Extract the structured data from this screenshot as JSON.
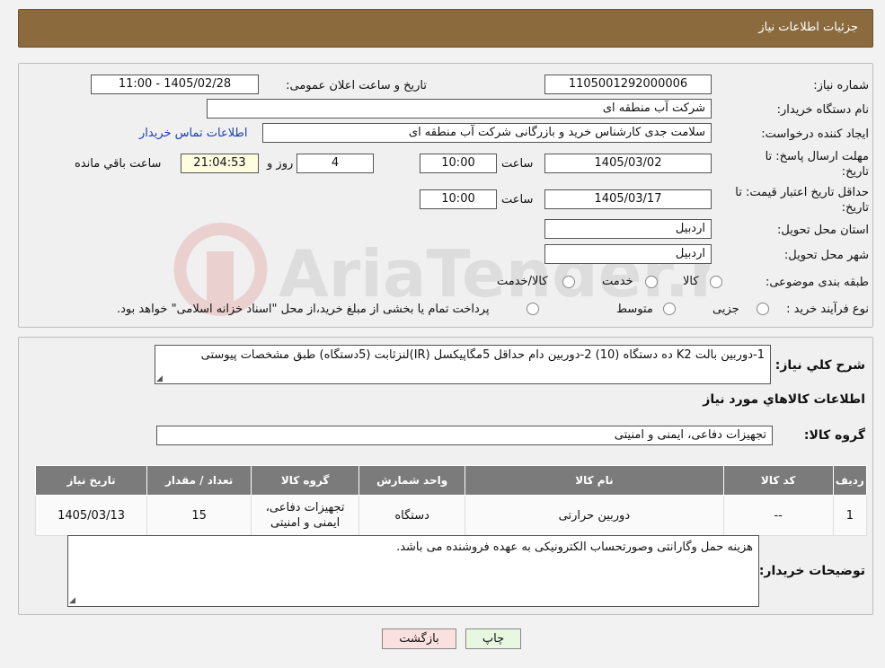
{
  "header": {
    "title": "جزئیات اطلاعات نیاز"
  },
  "details": {
    "need_number_label": "شماره نیاز:",
    "need_number": "1105001292000006",
    "announce_label": "تاریخ و ساعت اعلان عمومی:",
    "announce_value": "1405/02/28 - 11:00",
    "buyer_org_label": "نام دستگاه خریدار:",
    "buyer_org": "شرکت آب منطقه ای",
    "creator_label": "ایجاد کننده درخواست:",
    "creator": "سلامت جدی کارشناس خرید و بازرگانی شرکت آب منطقه ای",
    "contact_link": "اطلاعات تماس خریدار",
    "reply_deadline_label_1": "مهلت ارسال پاسخ: تا",
    "reply_deadline_label_2": "تاریخ:",
    "reply_date": "1405/03/02",
    "time_label": "ساعت",
    "reply_time": "10:00",
    "days_value": "4",
    "days_label": "روز و",
    "remaining_time": "21:04:53",
    "remaining_label": "ساعت باقي مانده",
    "price_validity_label_1": "حداقل تاریخ اعتبار قیمت: تا",
    "price_validity_label_2": "تاریخ:",
    "validity_date": "1405/03/17",
    "validity_time": "10:00",
    "province_label": "استان محل تحویل:",
    "province": "اردبیل",
    "city_label": "شهر محل تحویل:",
    "city": "اردبیل",
    "category_label": "طبقه بندی موضوعی:",
    "category_options": [
      "کالا",
      "خدمت",
      "کالا/خدمت"
    ],
    "process_label": "نوع فرآیند خرید :",
    "process_options": [
      "جزیی",
      "متوسط"
    ],
    "process_note": "پرداخت تمام یا بخشی از مبلغ خرید،از محل \"اسناد خزانه اسلامی\" خواهد بود."
  },
  "summary": {
    "label": "شرح کلي نياز:",
    "text": "1-دوربین بالت K2  ده دستگاه (10) 2-دوربین دام حداقل 5مگاپیکسل (IR)لنزثابت (5دستگاه) طبق مشخصات پیوستی"
  },
  "goods": {
    "section_title": "اطلاعات کالاهاي مورد نياز",
    "group_label": "گروه کالا:",
    "group_value": "تجهیزات دفاعی، ایمنی و امنیتی",
    "columns": [
      "رديف",
      "کد کالا",
      "نام کالا",
      "واحد شمارش",
      "گروه کالا",
      "تعداد / مقدار",
      "تاريخ نياز"
    ],
    "rows": [
      {
        "index": "1",
        "code": "--",
        "name": "دوربین حرارتی",
        "unit": "دستگاه",
        "group_line1": "تجهیزات دفاعی،",
        "group_line2": "ایمنی و امنیتی",
        "qty": "15",
        "date": "1405/03/13"
      }
    ]
  },
  "buyer_notes": {
    "label": "توضیحات خریدار:",
    "text": "هزینه حمل وگارانتی وصورتحساب الکترونیکی به عهده فروشنده می باشد."
  },
  "buttons": {
    "print": "چاپ",
    "back": "بازگشت"
  },
  "watermark": {
    "text": "AriaTender.neT"
  },
  "colors": {
    "header": "#8b6b3d",
    "table_header": "#7b7b7b",
    "print_button": "#e8f8e0",
    "back_button": "#fbe0e0",
    "link": "#1a3fb3"
  }
}
